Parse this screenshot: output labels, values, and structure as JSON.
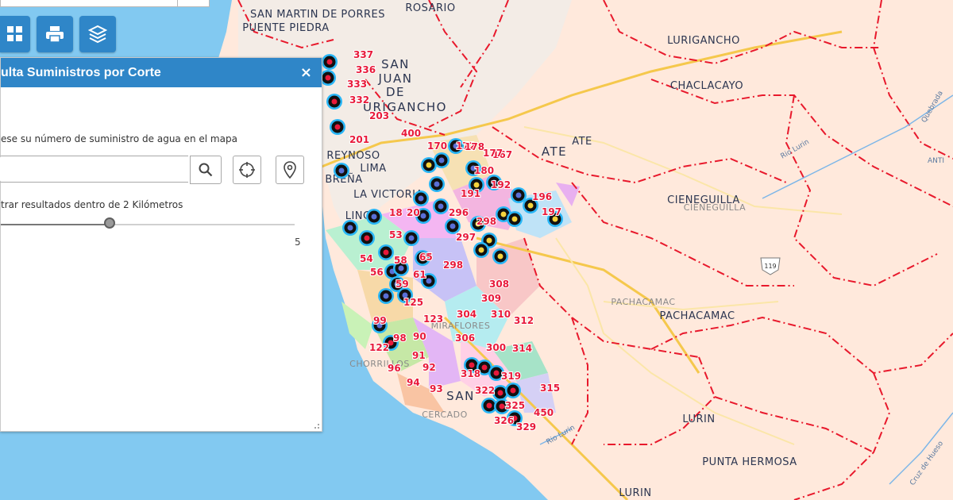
{
  "panel": {
    "title": "ulta Suministros por Corte",
    "close_label": "×",
    "instruction": "ese su número de suministro de agua en el mapa",
    "search_value": "",
    "filter_label": "trar resultados dentro de 2 Kilómetros",
    "slider_value": 2,
    "slider_max": 5,
    "slider_max_label": "5"
  },
  "toolbar": {
    "buttons": [
      {
        "icon": "grid-icon"
      },
      {
        "icon": "print-icon"
      },
      {
        "icon": "layers-icon"
      }
    ]
  },
  "colors": {
    "accent": "#2f86c8",
    "sea": "#82c9f1",
    "land": "#ffe9dc",
    "district_border": "#e8192c",
    "outage_number": "#e8193a"
  },
  "places": [
    "SAN MARTIN DE PORRES",
    "PUENTE PIEDRA",
    "ROSARIO",
    "SAN",
    "JUAN",
    "DE",
    "URIGANCHO",
    "LURIGANCHO",
    "CHACLACAYO",
    "ATE",
    "ATE",
    "REYNOSO",
    "LIMA",
    "BREÑA",
    "LA VICTORIA",
    "LINCE",
    "CIENEGUILLA",
    "CIENEGUILLA",
    "PACHACAMAC",
    "PACHACAMAC",
    "LURIN",
    "PUNTA HERMOSA",
    "LURIN",
    "CERCADO",
    "SAN",
    "MIRAFLORES",
    "CHORRILLOS"
  ],
  "road_labels": [
    "Rio Lurin",
    "Rio Lurin",
    "Quebrada",
    "Cruz de Hueso",
    "ANTI"
  ],
  "route_shield": "119",
  "outage_numbers": [
    "337",
    "336",
    "333",
    "332",
    "201",
    "203",
    "400",
    "170",
    "172",
    "167",
    "180",
    "191",
    "192",
    "196",
    "197",
    "18",
    "20",
    "53",
    "54",
    "56",
    "58",
    "59",
    "125",
    "61",
    "65",
    "298",
    "296",
    "297",
    "298",
    "308",
    "309",
    "310",
    "312",
    "300",
    "304",
    "306",
    "314",
    "99",
    "98",
    "90",
    "91",
    "92",
    "93",
    "94",
    "96",
    "122",
    "123",
    "318",
    "319",
    "322",
    "315",
    "325",
    "326",
    "329",
    "450",
    "178",
    "177"
  ]
}
